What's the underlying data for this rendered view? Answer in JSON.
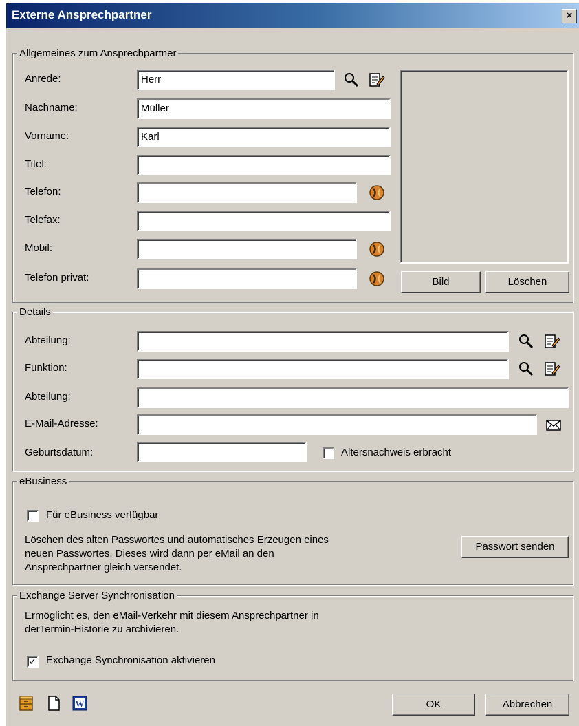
{
  "window": {
    "title": "Externe Ansprechpartner",
    "close_label": "×"
  },
  "general": {
    "legend": "Allgemeines zum Ansprechpartner",
    "fields": {
      "anrede": {
        "label": "Anrede:",
        "value": "Herr"
      },
      "nachname": {
        "label": "Nachname:",
        "value": "Müller"
      },
      "vorname": {
        "label": "Vorname:",
        "value": "Karl"
      },
      "titel": {
        "label": "Titel:",
        "value": ""
      },
      "telefon": {
        "label": "Telefon:",
        "value": ""
      },
      "telefax": {
        "label": "Telefax:",
        "value": ""
      },
      "mobil": {
        "label": "Mobil:",
        "value": ""
      },
      "telefon_privat": {
        "label": "Telefon privat:",
        "value": ""
      }
    },
    "bild_button": "Bild",
    "loeschen_button": "Löschen"
  },
  "details": {
    "legend": "Details",
    "fields": {
      "abteilung1": {
        "label": "Abteilung:",
        "value": ""
      },
      "funktion": {
        "label": "Funktion:",
        "value": ""
      },
      "abteilung2": {
        "label": "Abteilung:",
        "value": ""
      },
      "email": {
        "label": "E-Mail-Adresse:",
        "value": ""
      },
      "geburtsdatum": {
        "label": "Geburtsdatum:",
        "value": ""
      }
    },
    "altersnachweis": {
      "label": "Altersnachweis erbracht",
      "checked": false
    }
  },
  "ebusiness": {
    "legend": "eBusiness",
    "available": {
      "label": "Für eBusiness verfügbar",
      "checked": false
    },
    "description_lines": [
      "Löschen des alten Passwortes und automatisches Erzeugen eines",
      "neuen Passwortes. Dieses wird dann per eMail an den",
      "Ansprechpartner gleich versendet."
    ],
    "send_button": "Passwort senden"
  },
  "exchange": {
    "legend": "Exchange Server Synchronisation",
    "description_lines": [
      "Ermöglicht es, den eMail-Verkehr mit diesem Ansprechpartner in",
      "derTermin-Historie zu archivieren."
    ],
    "activate": {
      "label": "Exchange Synchronisation aktivieren",
      "checked": true,
      "mark": "✓"
    }
  },
  "footer": {
    "icons": [
      "cabinet-icon",
      "new-document-icon",
      "word-icon"
    ],
    "ok_button": "OK",
    "cancel_button": "Abbrechen"
  },
  "colors": {
    "title_start": "#0a246a",
    "title_end": "#a6caf0",
    "face": "#d4d0c8",
    "phone_icon": "#d9822b"
  }
}
